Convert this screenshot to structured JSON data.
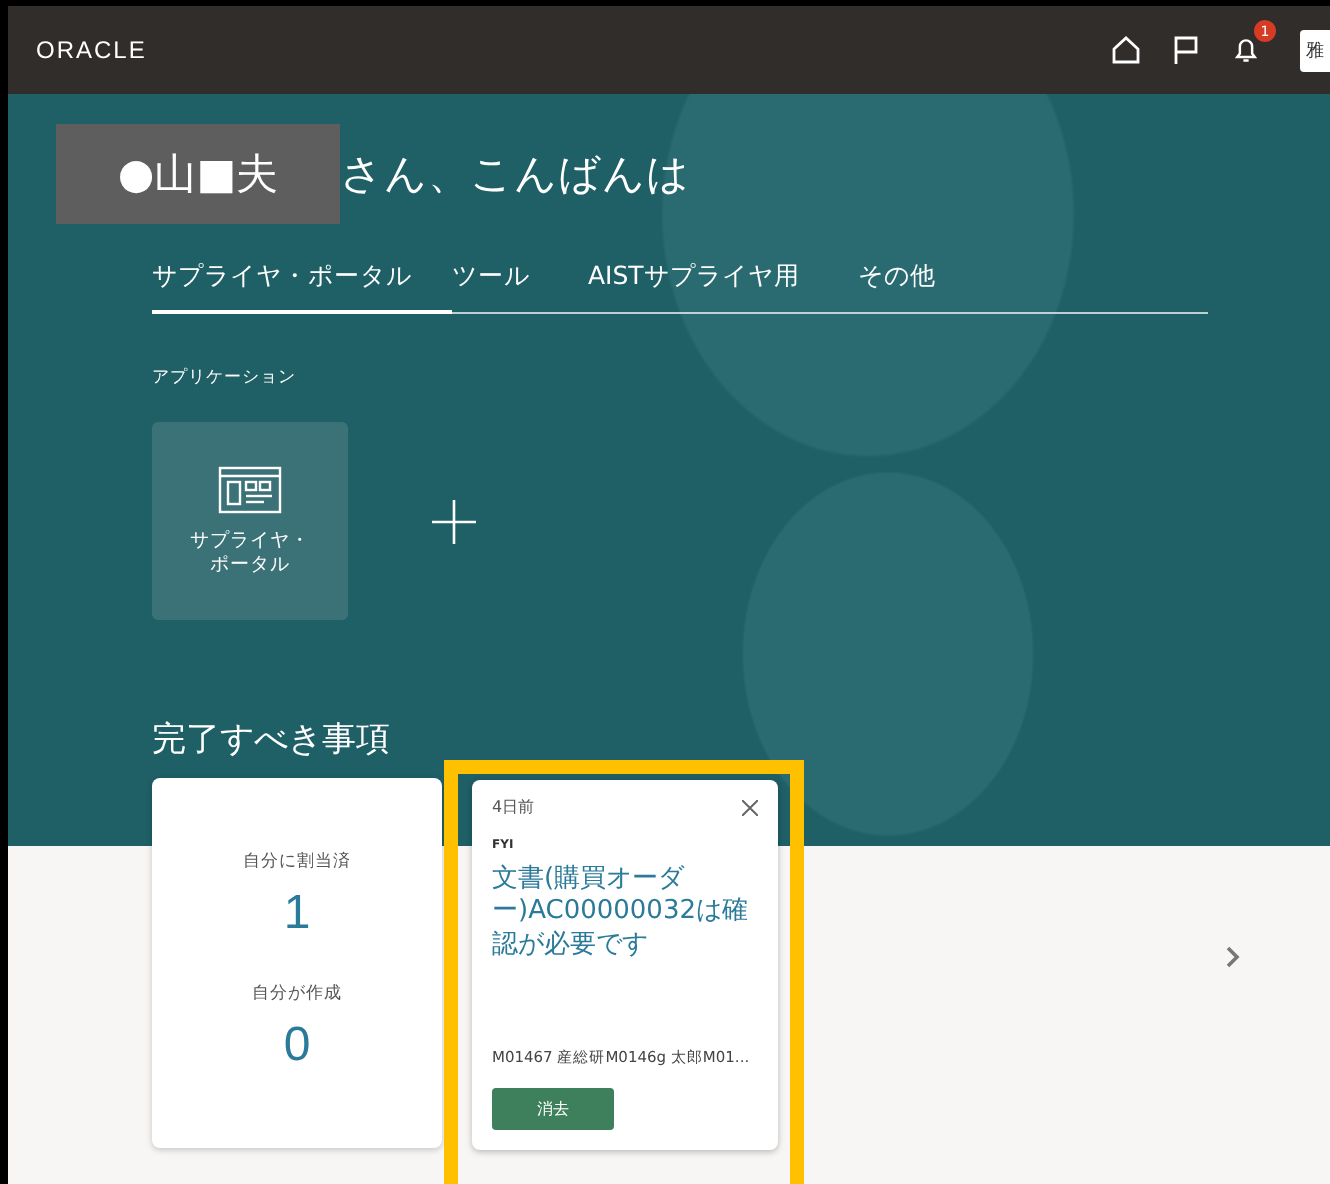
{
  "header": {
    "logo": "ORACLE",
    "notification_count": "1",
    "user_initials": "雅"
  },
  "greeting": {
    "name_redacted": "●山■夫",
    "text": "さん、こんばんは"
  },
  "tabs": [
    {
      "label": "サプライヤ・ポータル",
      "selected": true
    },
    {
      "label": "ツール",
      "selected": false
    },
    {
      "label": "AISTサプライヤ用",
      "selected": false
    },
    {
      "label": "その他",
      "selected": false
    }
  ],
  "section_label": "アプリケーション",
  "apps": [
    {
      "label": "サプライヤ・ポータル"
    }
  ],
  "todo": {
    "title": "完了すべき事項",
    "assigned_label": "自分に割当済",
    "assigned_count": "1",
    "created_label": "自分が作成",
    "created_count": "0"
  },
  "notification": {
    "age": "4日前",
    "type": "FYI",
    "message": "文書(購買オーダー)AC00000032は確認が必要です",
    "detail": "M01467 産総研M0146g 太郎M01...",
    "button": "消去",
    "highlighted": true
  }
}
